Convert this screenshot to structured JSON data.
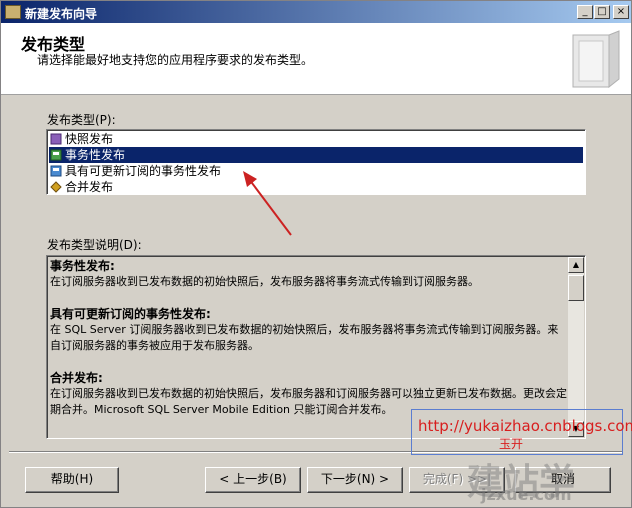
{
  "window": {
    "title": "新建发布向导",
    "controls": {
      "minimize": "_",
      "maximize": "□",
      "close": "×"
    }
  },
  "header": {
    "title": "发布类型",
    "description": "请选择能最好地支持您的应用程序要求的发布类型。"
  },
  "publication_type": {
    "label": "发布类型(P):",
    "selected_index": 1,
    "items": [
      {
        "label": "快照发布",
        "icon": "snapshot-publication-icon"
      },
      {
        "label": "事务性发布",
        "icon": "transactional-publication-icon"
      },
      {
        "label": "具有可更新订阅的事务性发布",
        "icon": "updatable-transactional-publication-icon"
      },
      {
        "label": "合并发布",
        "icon": "merge-publication-icon"
      }
    ]
  },
  "description": {
    "label": "发布类型说明(D):",
    "sections": [
      {
        "heading": "事务性发布:",
        "text": "在订阅服务器收到已发布数据的初始快照后，发布服务器将事务流式传输到订阅服务器。"
      },
      {
        "heading": "具有可更新订阅的事务性发布:",
        "text": "在 SQL Server 订阅服务器收到已发布数据的初始快照后，发布服务器将事务流式传输到订阅服务器。来自订阅服务器的事务被应用于发布服务器。"
      },
      {
        "heading": "合并发布:",
        "text": "在订阅服务器收到已发布数据的初始快照后，发布服务器和订阅服务器可以独立更新已发布数据。更改会定期合并。Microsoft SQL Server Mobile Edition 只能订阅合并发布。"
      }
    ]
  },
  "buttons": {
    "help": "帮助(H)",
    "back": "< 上一步(B)",
    "next": "下一步(N) >",
    "finish": "完成(F) >>|",
    "cancel": "取消"
  },
  "watermark": {
    "url": "http://yukaizhao.cnblogs.com",
    "name": "玉开",
    "logo": "建站学",
    "site": "jzxue.com"
  },
  "colors": {
    "selection": "#0a246a",
    "dialog_face": "#d4d0c8",
    "annotation_arrow": "#cc2222",
    "watermark_text": "#d81e1e"
  }
}
